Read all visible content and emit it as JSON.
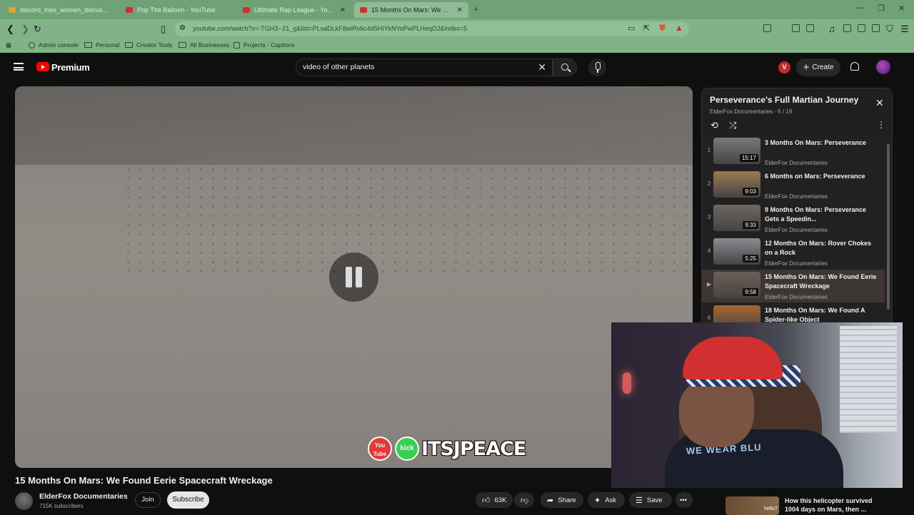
{
  "browser": {
    "tabs": [
      {
        "label": "discord_mes_women_discussion_nig...",
        "icon": "generic-tab-icon"
      },
      {
        "label": "Pop The Balloon - YouTube",
        "icon": "youtube-tab-icon"
      },
      {
        "label": "Ultimate Rap League - YouTube",
        "icon": "youtube-tab-icon"
      },
      {
        "label": "15 Months On Mars: We Fo...",
        "icon": "youtube-tab-icon",
        "active": true
      }
    ],
    "url": "youtube.com/watch?v=-TGH3--21_g&list=PLsaDLkF8wiRv6c4d5HIYkNYoPwPLHeqOJ&index=5",
    "bookmarks": [
      "Admin console",
      "Personal",
      "Creator Tools",
      "All Businesses",
      "Projects - Captions"
    ]
  },
  "youtube": {
    "logo_text": "Premium",
    "search_value": "video of other planets",
    "create_label": "Create",
    "avatar_letter": "V"
  },
  "video": {
    "title": "15 Months On Mars: We Found Eerie Spacecraft Wreckage",
    "channel": "ElderFox Documentaries",
    "subscribers": "715K subscribers",
    "join_label": "Join",
    "subscribe_label": "Subscribe",
    "likes": "63K",
    "share_label": "Share",
    "ask_label": "Ask",
    "save_label": "Save",
    "overlay": {
      "youtube_badge": "You Tube",
      "kick_badge": "kick",
      "streamer": "ITSJPEACE"
    }
  },
  "playlist": {
    "title": "Perseverance's Full Martian Journey",
    "subtitle": "ElderFox Documentaries - 5 / 19",
    "items": [
      {
        "index": "1",
        "title": "3 Months On Mars: Perseverance",
        "channel": "ElderFox Documentaries",
        "duration": "15:17",
        "thumb": "#7d7876"
      },
      {
        "index": "2",
        "title": "6 Months on Mars: Perseverance",
        "channel": "ElderFox Documentaries",
        "duration": "9:03",
        "thumb": "#9a7a50"
      },
      {
        "index": "3",
        "title": "9 Months On Mars: Perseverance Gets a Speedin...",
        "channel": "ElderFox Documentaries",
        "duration": "9:33",
        "thumb": "#6f6660"
      },
      {
        "index": "4",
        "title": "12 Months On Mars: Rover Chokes on a Rock",
        "channel": "ElderFox Documentaries",
        "duration": "5:25",
        "thumb": "#8a8c90"
      },
      {
        "index": "▶",
        "title": "15 Months On Mars: We Found Eerie Spacecraft Wreckage",
        "channel": "ElderFox Documentaries",
        "duration": "9:58",
        "thumb": "#6b6058",
        "current": true
      },
      {
        "index": "6",
        "title": "18 Months On Mars: We Found A Spider-like Object",
        "channel": "ElderFox Documentaries",
        "duration": "",
        "thumb": "#a8662e"
      }
    ]
  },
  "next_video": {
    "title": "How this helicopter survived",
    "title2": "1004 days on Mars, then ...",
    "thumb_text": "hello?"
  },
  "colors": {
    "chrome": "#6fa276",
    "youtube_red": "#ff0000",
    "background": "#0f0f0f"
  }
}
